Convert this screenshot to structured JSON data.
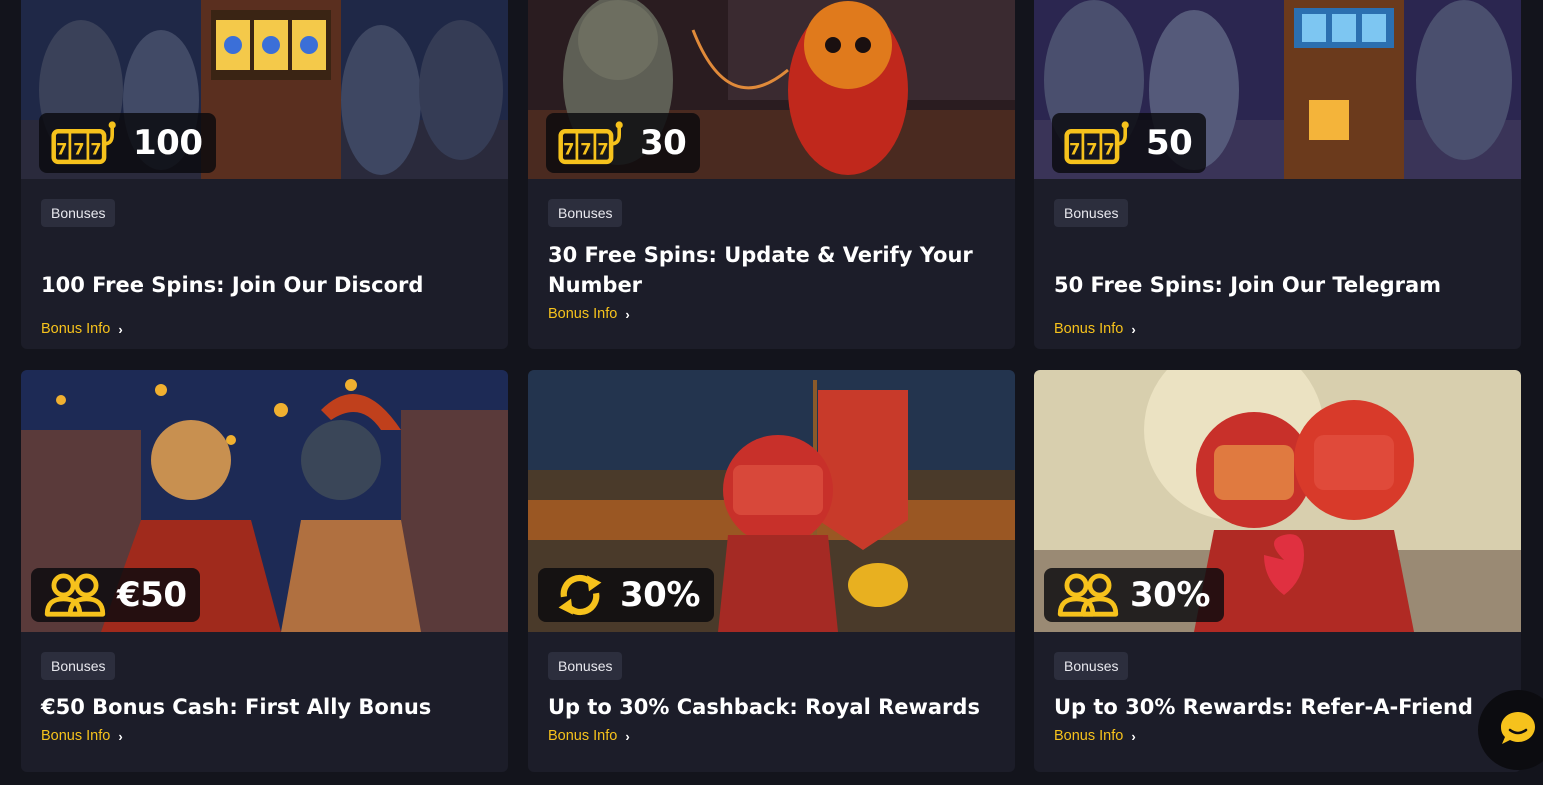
{
  "cards": [
    {
      "tag": "Bonuses",
      "title": "100 Free Spins: Join Our Discord",
      "value": "100",
      "badge_icon": "slot-777-icon",
      "link": "Bonus Info"
    },
    {
      "tag": "Bonuses",
      "title": "30 Free Spins: Update & Verify Your Number",
      "value": "30",
      "badge_icon": "slot-777-icon",
      "link": "Bonus Info"
    },
    {
      "tag": "Bonuses",
      "title": "50 Free Spins: Join Our Telegram",
      "value": "50",
      "badge_icon": "slot-777-icon",
      "link": "Bonus Info"
    },
    {
      "tag": "Bonuses",
      "title": "€50 Bonus Cash: First Ally Bonus",
      "value": "€50",
      "badge_icon": "users-icon",
      "link": "Bonus Info"
    },
    {
      "tag": "Bonuses",
      "title": "Up to 30% Cashback: Royal Rewards",
      "value": "30%",
      "badge_icon": "refresh-icon",
      "link": "Bonus Info"
    },
    {
      "tag": "Bonuses",
      "title": "Up to 30% Rewards: Refer-A-Friend",
      "value": "30%",
      "badge_icon": "users-icon",
      "link": "Bonus Info"
    }
  ],
  "colors": {
    "accent": "#f6c21c",
    "card_bg": "#1c1d29",
    "page_bg": "#13141c",
    "tag_bg": "#2c2e3d"
  },
  "chat": {
    "icon": "chat-bubble-icon"
  }
}
